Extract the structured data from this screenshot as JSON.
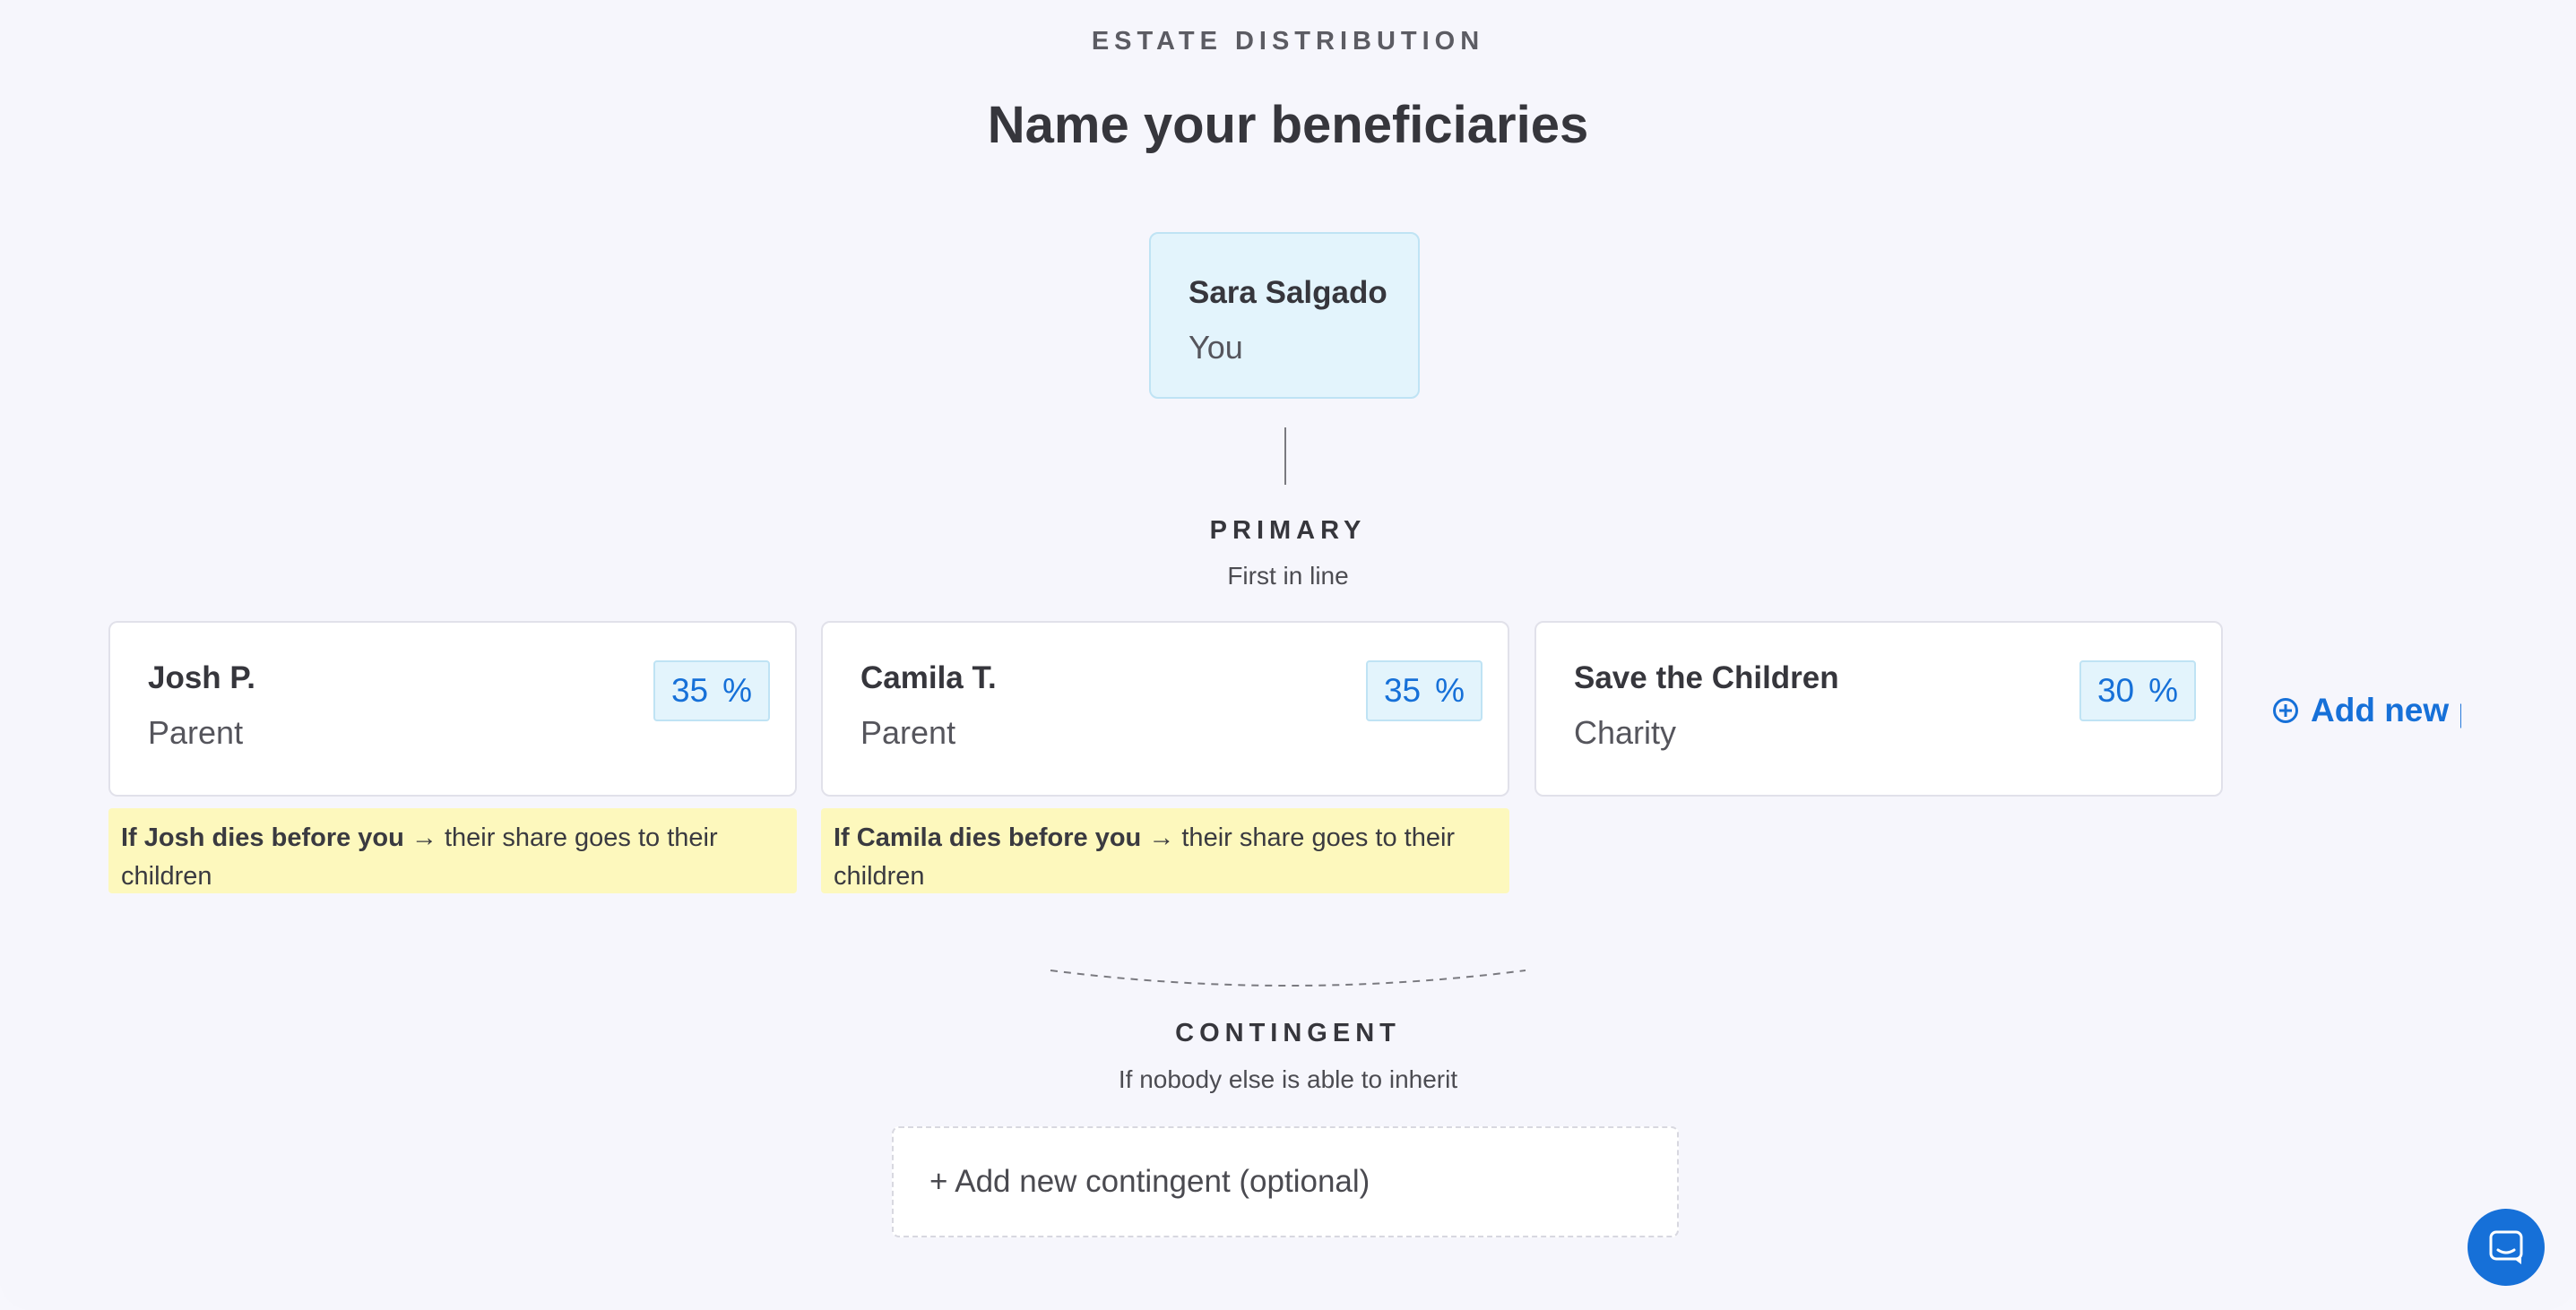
{
  "header": {
    "eyebrow": "ESTATE DISTRIBUTION",
    "title": "Name your beneficiaries"
  },
  "owner": {
    "name": "Sara Salgado",
    "role": "You"
  },
  "primary": {
    "label": "PRIMARY",
    "sub": "First in line",
    "beneficiaries": [
      {
        "name": "Josh P.",
        "role": "Parent",
        "percent": "35",
        "percent_sign": "%",
        "note_bold": "If Josh dies before you",
        "note_rest": " → their share goes to their children"
      },
      {
        "name": "Camila T.",
        "role": "Parent",
        "percent": "35",
        "percent_sign": "%",
        "note_bold": "If Camila dies before you",
        "note_rest": " → their share goes to their children"
      },
      {
        "name": "Save the Children",
        "role": "Charity",
        "percent": "30",
        "percent_sign": "%"
      }
    ],
    "add_label": "Add new p"
  },
  "contingent": {
    "label": "CONTINGENT",
    "sub": "If nobody else is able to inherit",
    "add_label": "+ Add new contingent (optional)"
  },
  "colors": {
    "accent": "#1670d8",
    "card_highlight": "#e3f4fc",
    "note_bg": "#fdf8bd"
  },
  "icons": {
    "add": "plus-circle-icon",
    "chat": "chat-icon"
  }
}
